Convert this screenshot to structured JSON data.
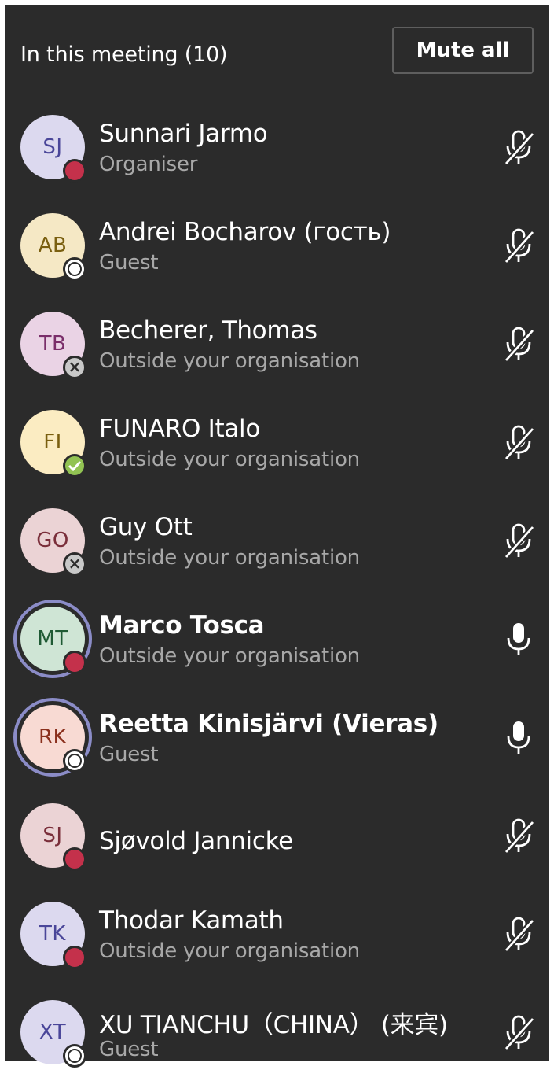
{
  "header": {
    "title": "In this meeting (10)",
    "mute_all_label": "Mute all"
  },
  "participants": [
    {
      "initials": "SJ",
      "name": "Sunnari Jarmo",
      "role": "Organiser",
      "status": "busy",
      "status_icon": "busy-status-icon",
      "mic": "muted",
      "mic_icon": "mic-off-icon",
      "avatar_bg": "#dcd9ef",
      "avatar_fg": "#4a4699"
    },
    {
      "initials": "AB",
      "name": "Andrei Bocharov (гость)",
      "role": "Guest",
      "status": "offline",
      "status_icon": "offline-status-icon",
      "mic": "muted",
      "mic_icon": "mic-off-icon",
      "avatar_bg": "#f5e8c5",
      "avatar_fg": "#7a5f10"
    },
    {
      "initials": "TB",
      "name": "Becherer, Thomas",
      "role": "Outside your organisation",
      "status": "away-x",
      "status_icon": "unknown-status-icon",
      "mic": "muted",
      "mic_icon": "mic-off-icon",
      "avatar_bg": "#ead3e5",
      "avatar_fg": "#7a2e6a"
    },
    {
      "initials": "FI",
      "name": "FUNARO Italo",
      "role": "Outside your organisation",
      "status": "available",
      "status_icon": "available-status-icon",
      "mic": "muted",
      "mic_icon": "mic-off-icon",
      "avatar_bg": "#fbecc2",
      "avatar_fg": "#7a5f10"
    },
    {
      "initials": "GO",
      "name": "Guy Ott",
      "role": "Outside your organisation",
      "status": "away-x",
      "status_icon": "unknown-status-icon",
      "mic": "muted",
      "mic_icon": "mic-off-icon",
      "avatar_bg": "#ebd3d5",
      "avatar_fg": "#7a2e3a"
    },
    {
      "initials": "MT",
      "name": "Marco Tosca",
      "role": "Outside your organisation",
      "status": "busy",
      "status_icon": "busy-status-icon",
      "mic": "on",
      "mic_icon": "mic-on-icon",
      "speaking": true,
      "avatar_bg": "#cfe5d5",
      "avatar_fg": "#1f5a34"
    },
    {
      "initials": "RK",
      "name": "Reetta Kinisjärvi (Vieras)",
      "role": "Guest",
      "status": "offline",
      "status_icon": "offline-status-icon",
      "mic": "on",
      "mic_icon": "mic-on-icon",
      "speaking": true,
      "avatar_bg": "#f8dad3",
      "avatar_fg": "#8a2f1c"
    },
    {
      "initials": "SJ",
      "name": "Sjøvold Jannicke",
      "role": "",
      "status": "busy",
      "status_icon": "busy-status-icon",
      "mic": "muted",
      "mic_icon": "mic-off-icon",
      "avatar_bg": "#ebd3d5",
      "avatar_fg": "#7a2e3a"
    },
    {
      "initials": "TK",
      "name": "Thodar Kamath",
      "role": "Outside your organisation",
      "status": "busy",
      "status_icon": "busy-status-icon",
      "mic": "muted",
      "mic_icon": "mic-off-icon",
      "avatar_bg": "#dcd9ef",
      "avatar_fg": "#4a4699"
    },
    {
      "initials": "XT",
      "name": "XU TIANCHU（CHINA） (来宾)",
      "role": "Guest",
      "status": "offline",
      "status_icon": "offline-status-icon",
      "mic": "muted",
      "mic_icon": "mic-off-icon",
      "avatar_bg": "#dcd9ef",
      "avatar_fg": "#4a4699"
    }
  ],
  "colors": {
    "panel_bg": "#2b2b2b",
    "busy": "#c4314b",
    "available": "#92c353",
    "speaking_ring": "#8b8cc7",
    "secondary_text": "#a8a8a8"
  }
}
